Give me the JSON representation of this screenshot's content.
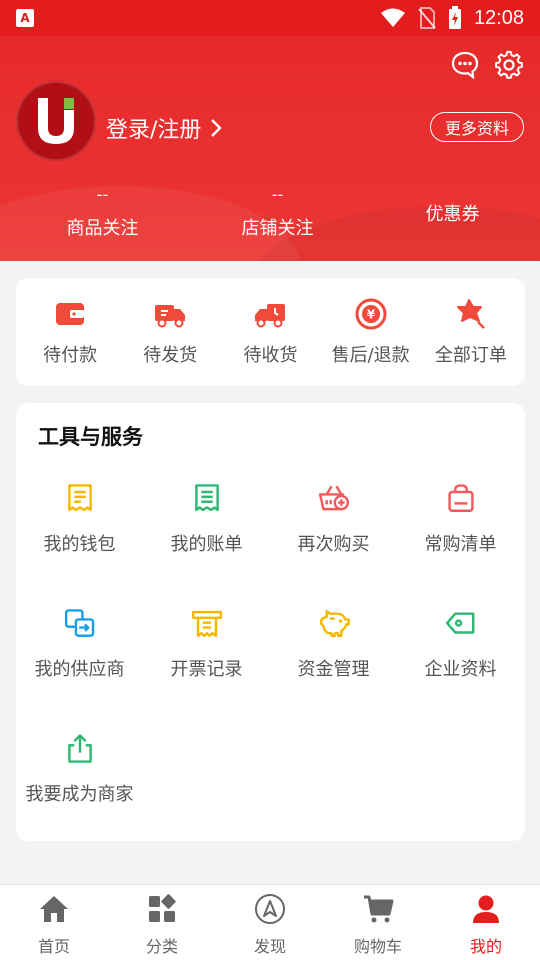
{
  "status_bar": {
    "time": "12:08",
    "app_badge": "A"
  },
  "header": {
    "login_label": "登录/注册",
    "more_info_label": "更多资料",
    "stats": [
      {
        "count": "--",
        "label": "商品关注"
      },
      {
        "count": "--",
        "label": "店铺关注"
      },
      {
        "count": "",
        "label": "优惠券"
      }
    ]
  },
  "orders": [
    {
      "label": "待付款",
      "icon": "wallet-icon"
    },
    {
      "label": "待发货",
      "icon": "truck-icon"
    },
    {
      "label": "待收货",
      "icon": "delivery-truck-icon"
    },
    {
      "label": "售后/退款",
      "icon": "refund-icon"
    },
    {
      "label": "全部订单",
      "icon": "all-orders-icon"
    }
  ],
  "tools": {
    "title": "工具与服务",
    "items": [
      {
        "label": "我的钱包",
        "icon": "wallet-receipt-icon"
      },
      {
        "label": "我的账单",
        "icon": "bill-icon"
      },
      {
        "label": "再次购买",
        "icon": "basket-plus-icon"
      },
      {
        "label": "常购清单",
        "icon": "shopping-bag-icon"
      },
      {
        "label": "我的供应商",
        "icon": "supplier-icon"
      },
      {
        "label": "开票记录",
        "icon": "invoice-icon"
      },
      {
        "label": "资金管理",
        "icon": "piggy-bank-icon"
      },
      {
        "label": "企业资料",
        "icon": "tag-icon"
      },
      {
        "label": "我要成为商家",
        "icon": "share-upload-icon"
      }
    ]
  },
  "bottom_nav": [
    {
      "label": "首页",
      "icon": "home-icon"
    },
    {
      "label": "分类",
      "icon": "category-icon"
    },
    {
      "label": "发现",
      "icon": "discover-icon"
    },
    {
      "label": "购物车",
      "icon": "cart-icon"
    },
    {
      "label": "我的",
      "icon": "user-icon",
      "active": true
    }
  ],
  "colors": {
    "brand_red": "#e31d1d",
    "yellow": "#f5b800",
    "green": "#2eb872",
    "blue": "#1aa0e8",
    "pink": "#f25b5b"
  }
}
